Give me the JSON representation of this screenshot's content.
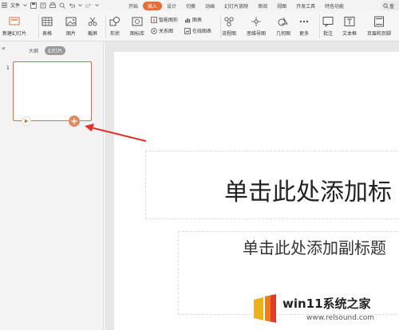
{
  "menubar": {
    "file_label": "文件",
    "tabs": [
      {
        "label": "开始",
        "active": false
      },
      {
        "label": "插入",
        "active": true
      },
      {
        "label": "设计",
        "active": false
      },
      {
        "label": "切换",
        "active": false
      },
      {
        "label": "动画",
        "active": false
      },
      {
        "label": "幻灯片放映",
        "active": false
      },
      {
        "label": "审阅",
        "active": false
      },
      {
        "label": "视图",
        "active": false
      },
      {
        "label": "开发工具",
        "active": false
      },
      {
        "label": "特色功能",
        "active": false
      }
    ],
    "search_label": "查"
  },
  "ribbon": {
    "new_slide": "新建幻灯片",
    "table": "表格",
    "picture": "图片",
    "screenshot": "截屏",
    "shape": "形状",
    "icon_library": "图标库",
    "smart_graphic": "智能图形",
    "relation_graph": "关系图",
    "chart": "图表",
    "online_chart": "在线图表",
    "flowchart": "流程图",
    "mindmap": "思维导图",
    "geometry": "几何图",
    "more": "更多",
    "comment": "批注",
    "textbox": "文本框",
    "header_footer": "页眉和页脚"
  },
  "panel": {
    "tab_outline": "大纲",
    "tab_slides": "幻灯片",
    "slide_number": "1"
  },
  "slide": {
    "title_placeholder": "单击此处添加标",
    "subtitle_placeholder": "单击此处添加副标题"
  },
  "watermark": {
    "text": "win11系统之家",
    "url": "www.relsound.com"
  },
  "colors": {
    "accent": "#e86c36",
    "arrow": "#e0322a"
  }
}
